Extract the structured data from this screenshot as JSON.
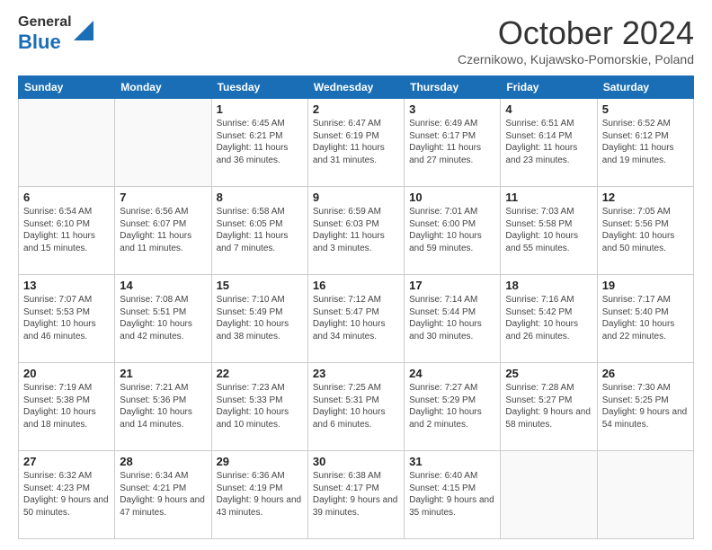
{
  "header": {
    "logo": {
      "general": "General",
      "blue": "Blue",
      "triangle_color": "#1a6eb5"
    },
    "title": "October 2024",
    "location": "Czernikowo, Kujawsko-Pomorskie, Poland"
  },
  "calendar": {
    "days_of_week": [
      "Sunday",
      "Monday",
      "Tuesday",
      "Wednesday",
      "Thursday",
      "Friday",
      "Saturday"
    ],
    "weeks": [
      [
        {
          "day": "",
          "info": ""
        },
        {
          "day": "",
          "info": ""
        },
        {
          "day": "1",
          "info": "Sunrise: 6:45 AM\nSunset: 6:21 PM\nDaylight: 11 hours and 36 minutes."
        },
        {
          "day": "2",
          "info": "Sunrise: 6:47 AM\nSunset: 6:19 PM\nDaylight: 11 hours and 31 minutes."
        },
        {
          "day": "3",
          "info": "Sunrise: 6:49 AM\nSunset: 6:17 PM\nDaylight: 11 hours and 27 minutes."
        },
        {
          "day": "4",
          "info": "Sunrise: 6:51 AM\nSunset: 6:14 PM\nDaylight: 11 hours and 23 minutes."
        },
        {
          "day": "5",
          "info": "Sunrise: 6:52 AM\nSunset: 6:12 PM\nDaylight: 11 hours and 19 minutes."
        }
      ],
      [
        {
          "day": "6",
          "info": "Sunrise: 6:54 AM\nSunset: 6:10 PM\nDaylight: 11 hours and 15 minutes."
        },
        {
          "day": "7",
          "info": "Sunrise: 6:56 AM\nSunset: 6:07 PM\nDaylight: 11 hours and 11 minutes."
        },
        {
          "day": "8",
          "info": "Sunrise: 6:58 AM\nSunset: 6:05 PM\nDaylight: 11 hours and 7 minutes."
        },
        {
          "day": "9",
          "info": "Sunrise: 6:59 AM\nSunset: 6:03 PM\nDaylight: 11 hours and 3 minutes."
        },
        {
          "day": "10",
          "info": "Sunrise: 7:01 AM\nSunset: 6:00 PM\nDaylight: 10 hours and 59 minutes."
        },
        {
          "day": "11",
          "info": "Sunrise: 7:03 AM\nSunset: 5:58 PM\nDaylight: 10 hours and 55 minutes."
        },
        {
          "day": "12",
          "info": "Sunrise: 7:05 AM\nSunset: 5:56 PM\nDaylight: 10 hours and 50 minutes."
        }
      ],
      [
        {
          "day": "13",
          "info": "Sunrise: 7:07 AM\nSunset: 5:53 PM\nDaylight: 10 hours and 46 minutes."
        },
        {
          "day": "14",
          "info": "Sunrise: 7:08 AM\nSunset: 5:51 PM\nDaylight: 10 hours and 42 minutes."
        },
        {
          "day": "15",
          "info": "Sunrise: 7:10 AM\nSunset: 5:49 PM\nDaylight: 10 hours and 38 minutes."
        },
        {
          "day": "16",
          "info": "Sunrise: 7:12 AM\nSunset: 5:47 PM\nDaylight: 10 hours and 34 minutes."
        },
        {
          "day": "17",
          "info": "Sunrise: 7:14 AM\nSunset: 5:44 PM\nDaylight: 10 hours and 30 minutes."
        },
        {
          "day": "18",
          "info": "Sunrise: 7:16 AM\nSunset: 5:42 PM\nDaylight: 10 hours and 26 minutes."
        },
        {
          "day": "19",
          "info": "Sunrise: 7:17 AM\nSunset: 5:40 PM\nDaylight: 10 hours and 22 minutes."
        }
      ],
      [
        {
          "day": "20",
          "info": "Sunrise: 7:19 AM\nSunset: 5:38 PM\nDaylight: 10 hours and 18 minutes."
        },
        {
          "day": "21",
          "info": "Sunrise: 7:21 AM\nSunset: 5:36 PM\nDaylight: 10 hours and 14 minutes."
        },
        {
          "day": "22",
          "info": "Sunrise: 7:23 AM\nSunset: 5:33 PM\nDaylight: 10 hours and 10 minutes."
        },
        {
          "day": "23",
          "info": "Sunrise: 7:25 AM\nSunset: 5:31 PM\nDaylight: 10 hours and 6 minutes."
        },
        {
          "day": "24",
          "info": "Sunrise: 7:27 AM\nSunset: 5:29 PM\nDaylight: 10 hours and 2 minutes."
        },
        {
          "day": "25",
          "info": "Sunrise: 7:28 AM\nSunset: 5:27 PM\nDaylight: 9 hours and 58 minutes."
        },
        {
          "day": "26",
          "info": "Sunrise: 7:30 AM\nSunset: 5:25 PM\nDaylight: 9 hours and 54 minutes."
        }
      ],
      [
        {
          "day": "27",
          "info": "Sunrise: 6:32 AM\nSunset: 4:23 PM\nDaylight: 9 hours and 50 minutes."
        },
        {
          "day": "28",
          "info": "Sunrise: 6:34 AM\nSunset: 4:21 PM\nDaylight: 9 hours and 47 minutes."
        },
        {
          "day": "29",
          "info": "Sunrise: 6:36 AM\nSunset: 4:19 PM\nDaylight: 9 hours and 43 minutes."
        },
        {
          "day": "30",
          "info": "Sunrise: 6:38 AM\nSunset: 4:17 PM\nDaylight: 9 hours and 39 minutes."
        },
        {
          "day": "31",
          "info": "Sunrise: 6:40 AM\nSunset: 4:15 PM\nDaylight: 9 hours and 35 minutes."
        },
        {
          "day": "",
          "info": ""
        },
        {
          "day": "",
          "info": ""
        }
      ]
    ]
  }
}
